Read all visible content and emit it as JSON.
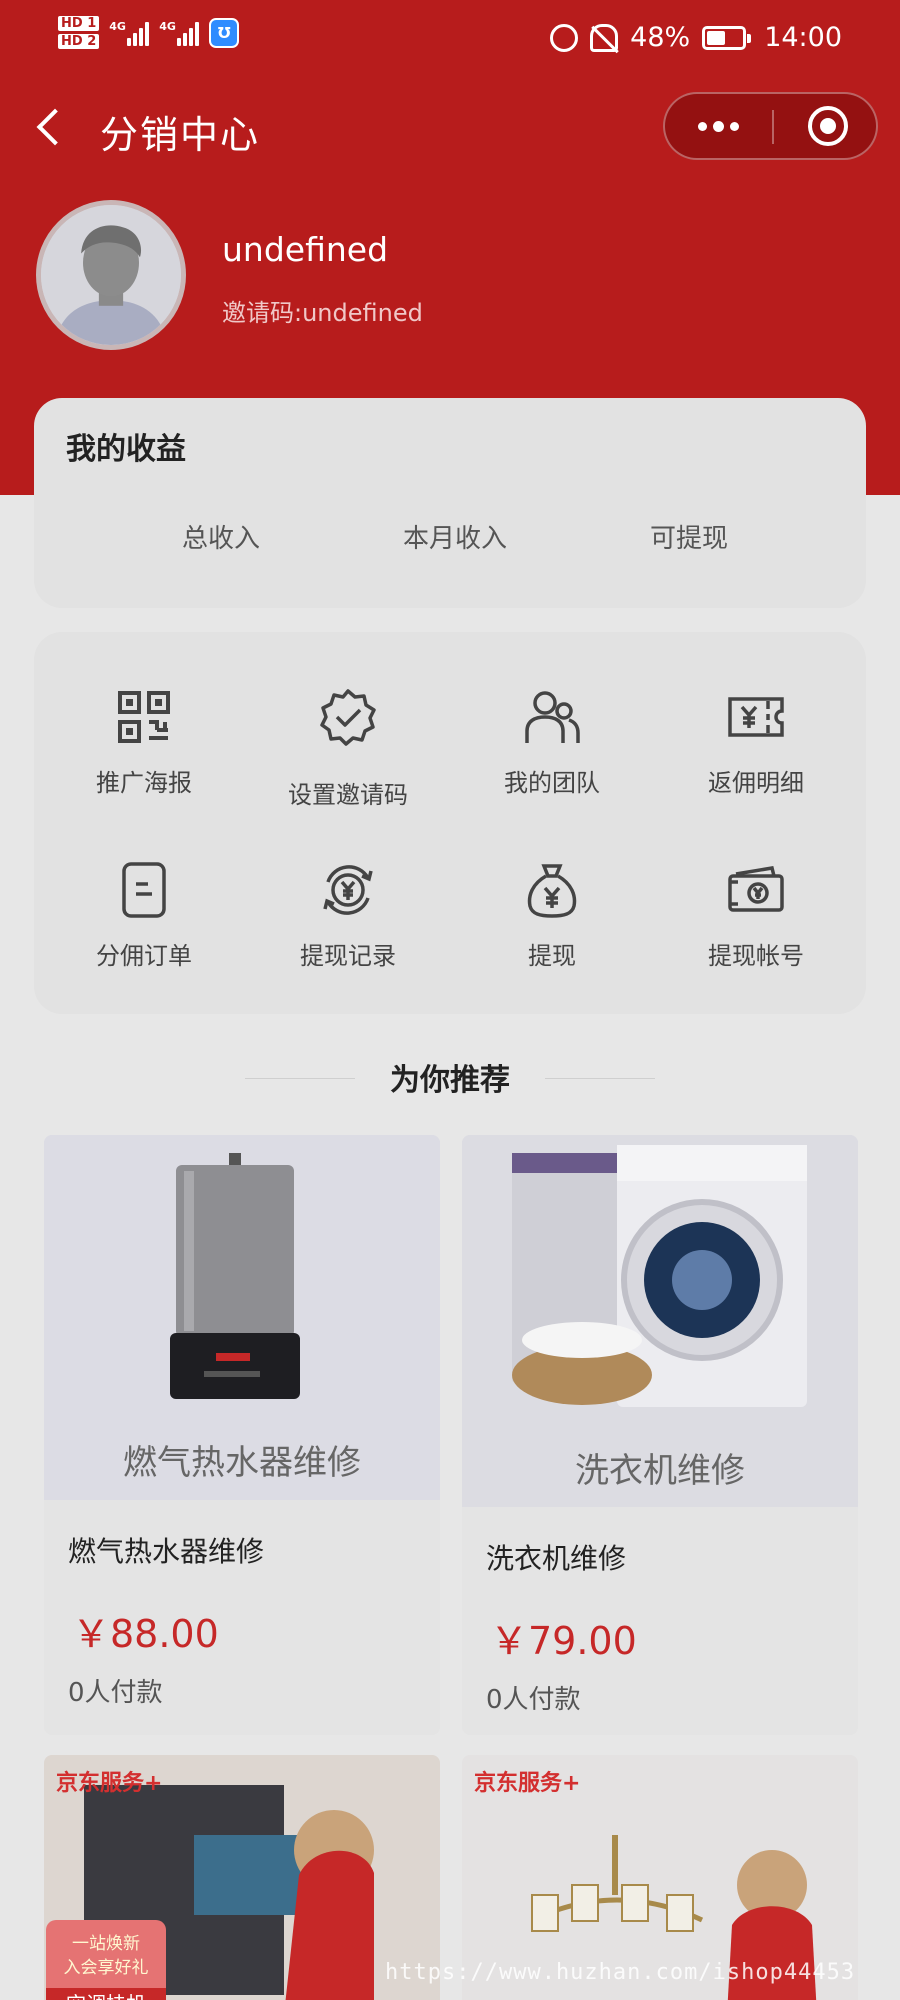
{
  "status_bar": {
    "hd1": "HD 1",
    "hd2": "HD 2",
    "net1": "4G",
    "net2": "4G",
    "battery": "48%",
    "time": "14:00"
  },
  "nav": {
    "title": "分销中心"
  },
  "profile": {
    "name": "undefined",
    "invite_code": "邀请码:undefined"
  },
  "earnings": {
    "title": "我的收益",
    "items": [
      "总收入",
      "本月收入",
      "可提现"
    ]
  },
  "menu": [
    {
      "label": "推广海报",
      "icon": "qrcode-icon"
    },
    {
      "label": "设置邀请码",
      "icon": "badge-check-icon"
    },
    {
      "label": "我的团队",
      "icon": "team-icon"
    },
    {
      "label": "返佣明细",
      "icon": "yen-ticket-icon"
    },
    {
      "label": "分佣订单",
      "icon": "order-doc-icon"
    },
    {
      "label": "提现记录",
      "icon": "yen-refresh-icon"
    },
    {
      "label": "提现",
      "icon": "money-bag-icon"
    },
    {
      "label": "提现帐号",
      "icon": "wallet-card-icon"
    }
  ],
  "recommend": {
    "title": "为你推荐",
    "products": [
      {
        "image_label": "燃气热水器维修",
        "name": "燃气热水器维修",
        "price": "￥88.00",
        "sold": "0人付款"
      },
      {
        "image_label": "洗衣机维修",
        "name": "洗衣机维修",
        "price": "￥79.00",
        "sold": "0人付款"
      }
    ],
    "partial": [
      {
        "tag": "京东服务+",
        "badge_line1": "一站焕新",
        "badge_line2": "入会享好礼",
        "badge_big": "空调挂机"
      },
      {
        "tag": "京东服务+"
      }
    ]
  },
  "watermark": "https://www.huzhan.com/ishop44453",
  "colors": {
    "primary": "#b71c1c",
    "price": "#c62828",
    "background": "#e7e7e7"
  }
}
